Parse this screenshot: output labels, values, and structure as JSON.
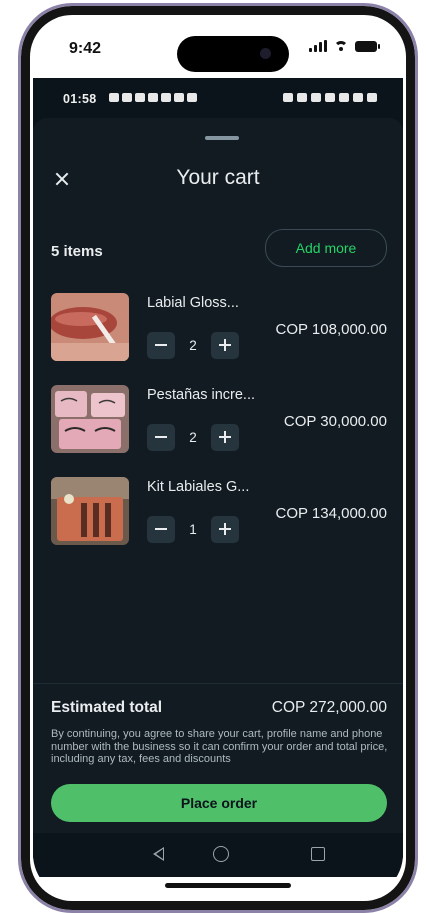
{
  "ios_status": {
    "time": "9:42"
  },
  "android_status": {
    "time": "01:58"
  },
  "header": {
    "title": "Your cart"
  },
  "cart": {
    "items_count": "5 items",
    "add_more_label": "Add more",
    "items": [
      {
        "name": "Labial Gloss...",
        "quantity": "2",
        "price": "COP 108,000.00"
      },
      {
        "name": "Pestañas incre...",
        "quantity": "2",
        "price": "COP 30,000.00"
      },
      {
        "name": "Kit Labiales G...",
        "quantity": "1",
        "price": "COP 134,000.00"
      }
    ]
  },
  "footer": {
    "estimated_total_label": "Estimated total",
    "estimated_total_value": "COP 272,000.00",
    "disclaimer": "By continuing, you agree to share your cart, profile name and phone number with the business so it can confirm your order and total price, including any tax, fees and discounts",
    "place_order_label": "Place order"
  },
  "colors": {
    "accent_green": "#25d366",
    "button_green": "#4fbf6a",
    "background": "#111b21"
  },
  "icons": [
    "close-icon",
    "minus-icon",
    "plus-icon",
    "back-icon",
    "home-icon",
    "recents-icon",
    "signal-icon",
    "wifi-icon",
    "battery-icon"
  ]
}
